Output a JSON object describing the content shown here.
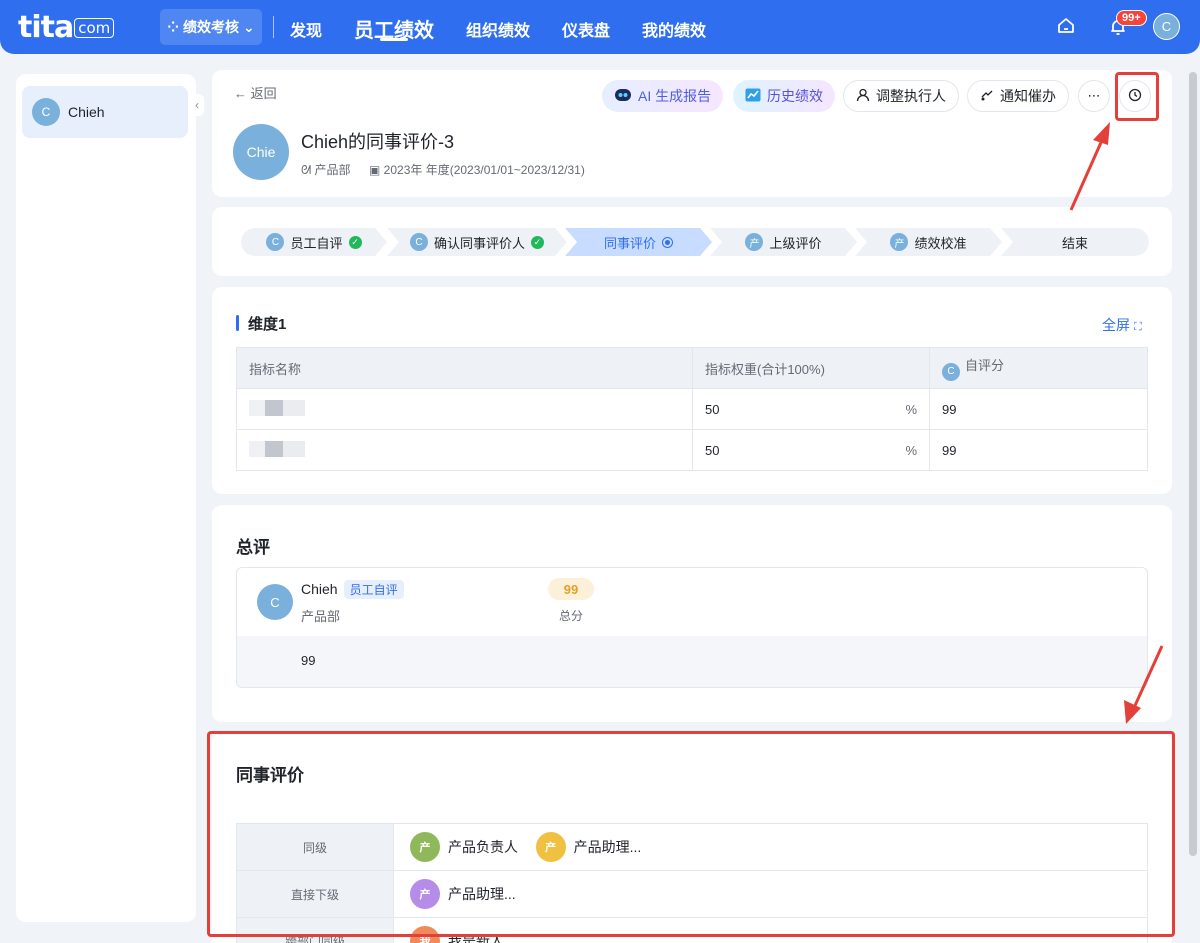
{
  "topbar": {
    "logo": "tita",
    "logo_suffix": "com",
    "module": "绩效考核",
    "nav": [
      "发现",
      "员工绩效",
      "组织绩效",
      "仪表盘",
      "我的绩效"
    ],
    "notifications": "99+",
    "avatar": "C"
  },
  "sidebar": {
    "user_avatar": "C",
    "user_name": "Chieh"
  },
  "header": {
    "back": "返回",
    "buttons": {
      "ai": "AI 生成报告",
      "history": "历史绩效",
      "adjust": "调整执行人",
      "notify": "通知催办"
    },
    "avatar": "Chie",
    "title": "Chieh的同事评价-3",
    "department": "产品部",
    "period": "2023年 年度(2023/01/01~2023/12/31)"
  },
  "steps": [
    {
      "avatar": "C",
      "label": "员工自评",
      "state": "done"
    },
    {
      "avatar": "C",
      "label": "确认同事评价人",
      "state": "done"
    },
    {
      "avatar": "",
      "label": "同事评价",
      "state": "current"
    },
    {
      "avatar": "产",
      "label": "上级评价",
      "state": "pending"
    },
    {
      "avatar": "产",
      "label": "绩效校准",
      "state": "pending"
    },
    {
      "avatar": "",
      "label": "结束",
      "state": "pending"
    }
  ],
  "dimension": {
    "title": "维度1",
    "fullscreen": "全屏",
    "columns": [
      "指标名称",
      "指标权重(合计100%)",
      "自评分"
    ],
    "col3_avatar": "C",
    "rows": [
      {
        "weight": "50",
        "unit": "%",
        "score": "99"
      },
      {
        "weight": "50",
        "unit": "%",
        "score": "99"
      }
    ]
  },
  "summary": {
    "title": "总评",
    "avatar": "C",
    "name": "Chieh",
    "tag": "员工自评",
    "department": "产品部",
    "score": "99",
    "score_label": "总分",
    "comment": "99"
  },
  "peer": {
    "title": "同事评价",
    "rows": [
      {
        "label": "同级",
        "people": [
          {
            "avatar": "产",
            "name": "产品负责人",
            "color": "#8fb85a"
          },
          {
            "avatar": "产",
            "name": "产品助理...",
            "color": "#f0c040"
          }
        ]
      },
      {
        "label": "直接下级",
        "people": [
          {
            "avatar": "产",
            "name": "产品助理...",
            "color": "#b58ce8"
          }
        ]
      },
      {
        "label": "跨部门同级",
        "people": [
          {
            "avatar": "我",
            "name": "我是新人...",
            "color": "#f08a5a"
          }
        ]
      }
    ]
  },
  "colors": {
    "primary": "#2f6fef",
    "highlight": "#e3403a",
    "success": "#1fb85a"
  }
}
